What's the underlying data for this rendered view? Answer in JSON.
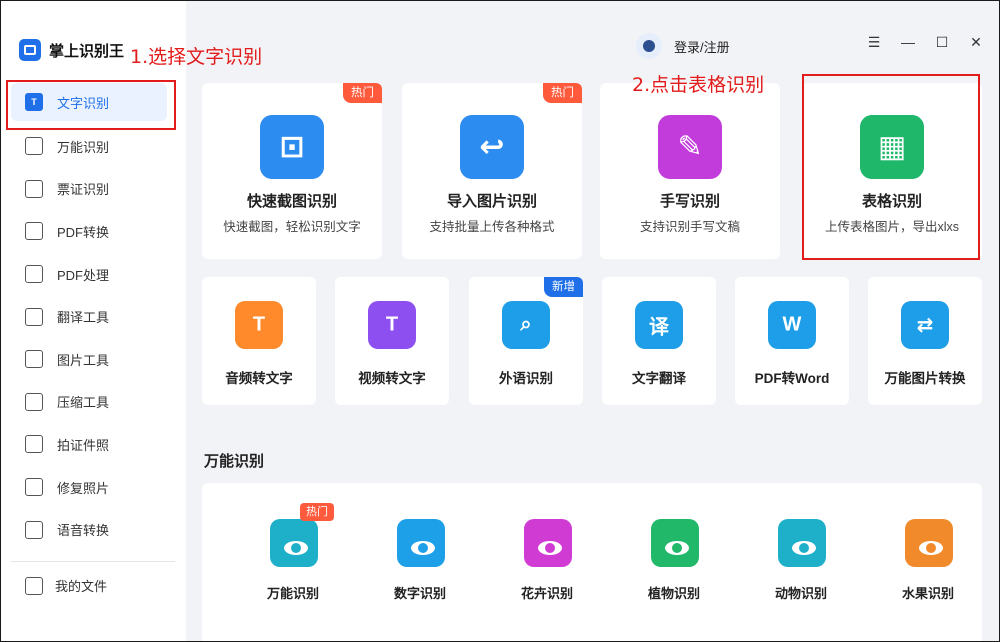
{
  "app": {
    "name": "掌上识别王"
  },
  "annotations": {
    "step1": "1.选择文字识别",
    "step2": "2.点击表格识别"
  },
  "sidebar": {
    "items": [
      {
        "label": "文字识别",
        "icon": "T"
      },
      {
        "label": "万能识别",
        "icon": ""
      },
      {
        "label": "票证识别",
        "icon": ""
      },
      {
        "label": "PDF转换",
        "icon": ""
      },
      {
        "label": "PDF处理",
        "icon": ""
      },
      {
        "label": "翻译工具",
        "icon": ""
      },
      {
        "label": "图片工具",
        "icon": ""
      },
      {
        "label": "压缩工具",
        "icon": ""
      },
      {
        "label": "拍证件照",
        "icon": ""
      },
      {
        "label": "修复照片",
        "icon": ""
      },
      {
        "label": "语音转换",
        "icon": ""
      }
    ],
    "files_label": "我的文件"
  },
  "header": {
    "login_label": "登录/注册",
    "menu_glyph": "☰",
    "min_glyph": "—",
    "max_glyph": "☐",
    "close_glyph": "✕"
  },
  "features": [
    {
      "title": "快速截图识别",
      "desc": "快速截图，轻松识别文字",
      "badge": "热门",
      "color": "#2d8cf0",
      "icon": "crop-icon",
      "sym": "⊡"
    },
    {
      "title": "导入图片识别",
      "desc": "支持批量上传各种格式",
      "badge": "热门",
      "color": "#2d8cf0",
      "icon": "import-image-icon",
      "sym": "↩"
    },
    {
      "title": "手写识别",
      "desc": "支持识别手写文稿",
      "badge": "",
      "color": "#c23bdb",
      "icon": "handwriting-icon",
      "sym": "✎"
    },
    {
      "title": "表格识别",
      "desc": "上传表格图片，导出xlxs",
      "badge": "",
      "color": "#1fb86b",
      "icon": "table-icon",
      "sym": "▦"
    }
  ],
  "tools": [
    {
      "title": "音频转文字",
      "badge": "",
      "color": "#ff8a2b",
      "icon": "audio-icon",
      "sym": "T"
    },
    {
      "title": "视频转文字",
      "badge": "",
      "color": "#8e4ff0",
      "icon": "video-icon",
      "sym": "T"
    },
    {
      "title": "外语识别",
      "badge": "新增",
      "color": "#1e9ee8",
      "icon": "foreign-language-icon",
      "sym": "⌕"
    },
    {
      "title": "文字翻译",
      "badge": "",
      "color": "#1e9ee8",
      "icon": "translate-icon",
      "sym": "译"
    },
    {
      "title": "PDF转Word",
      "badge": "",
      "color": "#1e9ee8",
      "icon": "pdf-word-icon",
      "sym": "W"
    },
    {
      "title": "万能图片转换",
      "badge": "",
      "color": "#1e9ee8",
      "icon": "image-convert-icon",
      "sym": "⇄"
    }
  ],
  "section": {
    "title": "万能识别"
  },
  "recognitions": [
    {
      "title": "万能识别",
      "badge": "热门",
      "color": "#1eb0c8",
      "icon": "universal-eye-icon"
    },
    {
      "title": "数字识别",
      "badge": "",
      "color": "#1ea0e8",
      "icon": "number-eye-icon"
    },
    {
      "title": "花卉识别",
      "badge": "",
      "color": "#d03bd4",
      "icon": "flower-eye-icon"
    },
    {
      "title": "植物识别",
      "badge": "",
      "color": "#22b86a",
      "icon": "plant-eye-icon"
    },
    {
      "title": "动物识别",
      "badge": "",
      "color": "#1eb0c8",
      "icon": "animal-eye-icon"
    },
    {
      "title": "水果识别",
      "badge": "",
      "color": "#f08a2b",
      "icon": "fruit-eye-icon"
    }
  ]
}
